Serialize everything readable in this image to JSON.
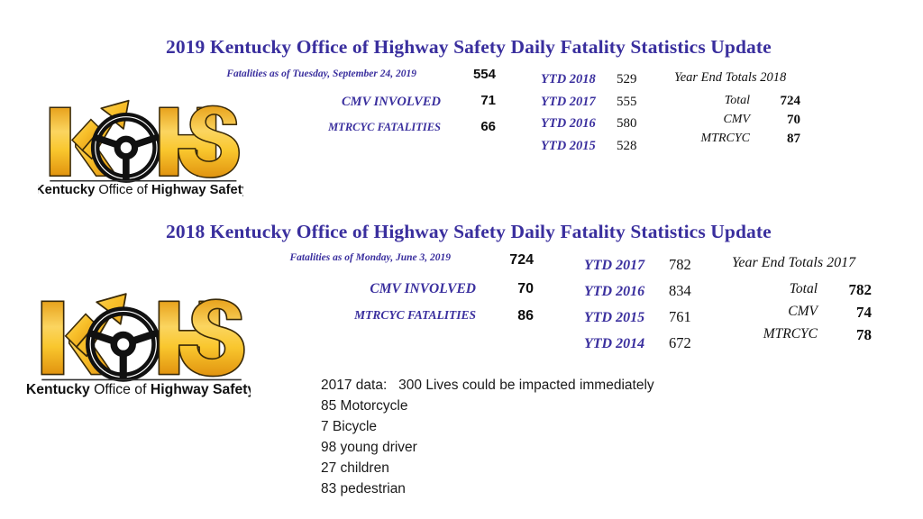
{
  "slide": {
    "background_color": "#ffffff",
    "accent_color": "#3A2F9E",
    "logo_gold": "#F6B221",
    "logo_gold_light": "#FCE08A",
    "logo_dark": "#1A1A1A"
  },
  "logo": {
    "alt": "Kentucky Office of Highway Safety",
    "letters": "KOHS",
    "tagline_bold_1": "Kentucky",
    "tagline_regular": " Office of ",
    "tagline_bold_2": "Highway Safety"
  },
  "section1": {
    "title": "2019 Kentucky Office of Highway Safety Daily Fatality Statistics Update",
    "left_rows": [
      {
        "label": "Fatalities as of  Tuesday, September 24, 2019",
        "value": "554"
      },
      {
        "label": "CMV INVOLVED",
        "value": "71"
      },
      {
        "label": "MTRCYC FATALITIES",
        "value": "66"
      }
    ],
    "ytd": [
      {
        "label": "YTD 2018",
        "value": "529"
      },
      {
        "label": "YTD 2017",
        "value": "555"
      },
      {
        "label": "YTD 2016",
        "value": "580"
      },
      {
        "label": "YTD 2015",
        "value": "528"
      }
    ],
    "year_end": {
      "title": "Year End Totals 2018",
      "rows": [
        {
          "label": "Total",
          "value": "724"
        },
        {
          "label": "CMV",
          "value": "70"
        },
        {
          "label": "MTRCYC",
          "value": "87"
        }
      ]
    }
  },
  "section2": {
    "title": "2018 Kentucky Office of Highway Safety Daily Fatality Statistics Update",
    "left_rows": [
      {
        "label": "Fatalities as of  Monday, June 3, 2019",
        "value": "724"
      },
      {
        "label": "CMV INVOLVED",
        "value": "70"
      },
      {
        "label": "MTRCYC FATALITIES",
        "value": "86"
      }
    ],
    "ytd": [
      {
        "label": "YTD 2017",
        "value": "782"
      },
      {
        "label": "YTD 2016",
        "value": "834"
      },
      {
        "label": "YTD 2015",
        "value": "761"
      },
      {
        "label": "YTD 2014",
        "value": "672"
      }
    ],
    "year_end": {
      "title": "Year End Totals 2017",
      "rows": [
        {
          "label": "Total",
          "value": "782"
        },
        {
          "label": "CMV",
          "value": "74"
        },
        {
          "label": "MTRCYC",
          "value": "78"
        }
      ]
    }
  },
  "notes": {
    "lines": [
      "2017 data:   300 Lives could be impacted immediately",
      "85 Motorcycle",
      "7 Bicycle",
      "98 young driver",
      "27 children",
      "83 pedestrian"
    ]
  }
}
